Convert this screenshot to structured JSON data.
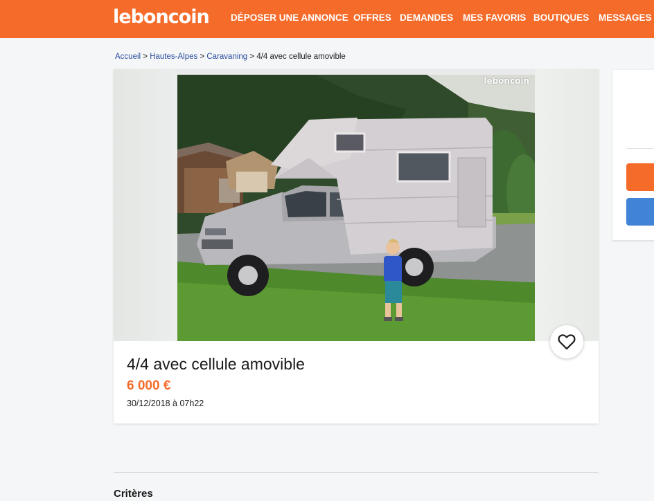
{
  "header": {
    "logo": "leboncoin",
    "nav": [
      {
        "label": "DÉPOSER UNE ANNONCE"
      },
      {
        "label": "OFFRES"
      },
      {
        "label": "DEMANDES"
      },
      {
        "label": "MES FAVORIS"
      },
      {
        "label": "BOUTIQUES"
      },
      {
        "label": "MESSAGES"
      }
    ]
  },
  "breadcrumb": {
    "items": [
      "Accueil",
      "Hautes-Alpes",
      "Caravaning"
    ],
    "current": "4/4 avec cellule amovible",
    "separator": ">"
  },
  "listing": {
    "watermark": "leboncoin",
    "title": "4/4 avec cellule amovible",
    "price": "6 000 €",
    "date": "30/12/2018 à 07h22",
    "favorite_icon": "heart-icon"
  },
  "criteria": {
    "title": "Critères"
  },
  "colors": {
    "brand_orange": "#f56b2a",
    "link_blue": "#2d4ea0",
    "button_blue": "#4183d7",
    "background": "#f4f6f7"
  }
}
